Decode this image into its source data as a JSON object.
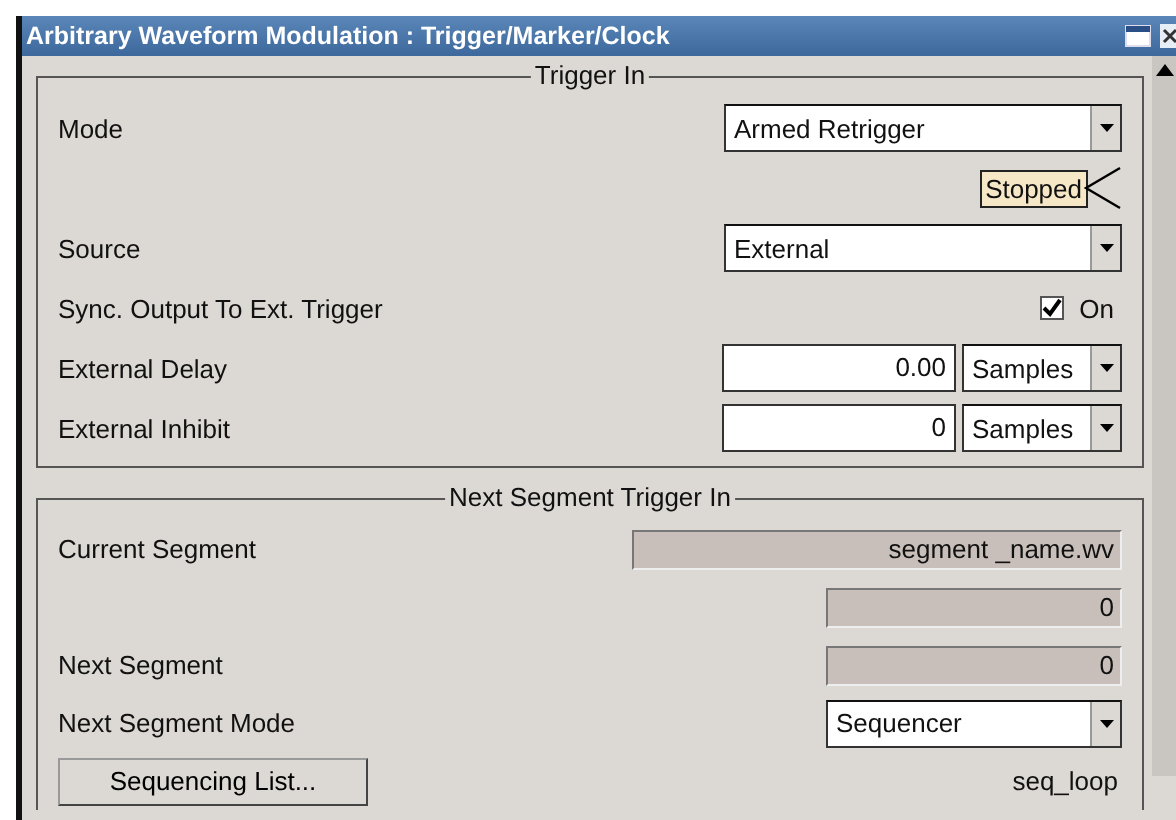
{
  "window": {
    "title": "Arbitrary Waveform Modulation : Trigger/Marker/Clock"
  },
  "trigger_in": {
    "title": "Trigger In",
    "rows": [
      {
        "kind": "select",
        "label": "Mode",
        "value": "Armed Retrigger"
      },
      {
        "kind": "status",
        "value": "Stopped"
      },
      {
        "kind": "select",
        "label": "Source",
        "value": "External"
      },
      {
        "kind": "checkbox",
        "label": "Sync. Output To Ext. Trigger",
        "checked": true,
        "text": "On"
      },
      {
        "kind": "number",
        "label": "External Delay",
        "value": "0.00",
        "unit": "Samples"
      },
      {
        "kind": "number",
        "label": "External Inhibit",
        "value": "0",
        "unit": "Samples"
      }
    ]
  },
  "next_segment": {
    "title": "Next Segment Trigger In",
    "rows": [
      {
        "kind": "readout",
        "label": "Current Segment",
        "value": "segment _name.wv",
        "wide": true
      },
      {
        "kind": "readout",
        "value": "0",
        "wide": false
      },
      {
        "kind": "readout",
        "label": "Next Segment",
        "value": "0",
        "wide": false
      },
      {
        "kind": "select",
        "label": "Next Segment Mode",
        "value": "Sequencer"
      },
      {
        "kind": "button",
        "label": "Sequencing List...",
        "value": "seq_loop"
      }
    ]
  }
}
